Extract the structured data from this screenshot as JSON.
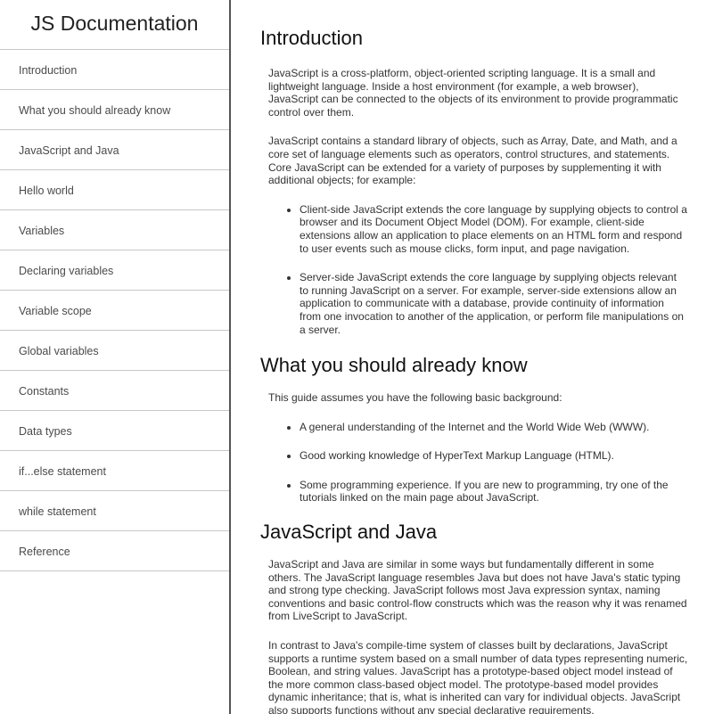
{
  "navbar": {
    "title": "JS Documentation",
    "items": [
      {
        "label": "Introduction"
      },
      {
        "label": "What you should already know"
      },
      {
        "label": "JavaScript and Java"
      },
      {
        "label": "Hello world"
      },
      {
        "label": "Variables"
      },
      {
        "label": "Declaring variables"
      },
      {
        "label": "Variable scope"
      },
      {
        "label": "Global variables"
      },
      {
        "label": "Constants"
      },
      {
        "label": "Data types"
      },
      {
        "label": "if...else statement"
      },
      {
        "label": "while statement"
      },
      {
        "label": "Reference"
      }
    ]
  },
  "sections": [
    {
      "title": "Introduction",
      "paragraphs": [
        "JavaScript is a cross-platform, object-oriented scripting language. It is a small and lightweight language. Inside a host environment (for example, a web browser), JavaScript can be connected to the objects of its environment to provide programmatic control over them.",
        "JavaScript contains a standard library of objects, such as Array, Date, and Math, and a core set of language elements such as operators, control structures, and statements. Core JavaScript can be extended for a variety of purposes by supplementing it with additional objects; for example:"
      ],
      "bullets": [
        "Client-side JavaScript extends the core language by supplying objects to control a browser and its Document Object Model (DOM). For example, client-side extensions allow an application to place elements on an HTML form and respond to user events such as mouse clicks, form input, and page navigation.",
        "Server-side JavaScript extends the core language by supplying objects relevant to running JavaScript on a server. For example, server-side extensions allow an application to communicate with a database, provide continuity of information from one invocation to another of the application, or perform file manipulations on a server."
      ]
    },
    {
      "title": "What you should already know",
      "paragraphs": [
        "This guide assumes you have the following basic background:"
      ],
      "bullets": [
        "A general understanding of the Internet and the World Wide Web (WWW).",
        "Good working knowledge of HyperText Markup Language (HTML).",
        "Some programming experience. If you are new to programming, try one of the tutorials linked on the main page about JavaScript."
      ]
    },
    {
      "title": "JavaScript and Java",
      "paragraphs": [
        "JavaScript and Java are similar in some ways but fundamentally different in some others. The JavaScript language resembles Java but does not have Java's static typing and strong type checking. JavaScript follows most Java expression syntax, naming conventions and basic control-flow constructs which was the reason why it was renamed from LiveScript to JavaScript.",
        "In contrast to Java's compile-time system of classes built by declarations, JavaScript supports a runtime system based on a small number of data types representing numeric, Boolean, and string values. JavaScript has a prototype-based object model instead of the more common class-based object model. The prototype-based model provides dynamic inheritance; that is, what is inherited can vary for individual objects. JavaScript also supports functions without any special declarative requirements."
      ],
      "bullets": []
    }
  ]
}
